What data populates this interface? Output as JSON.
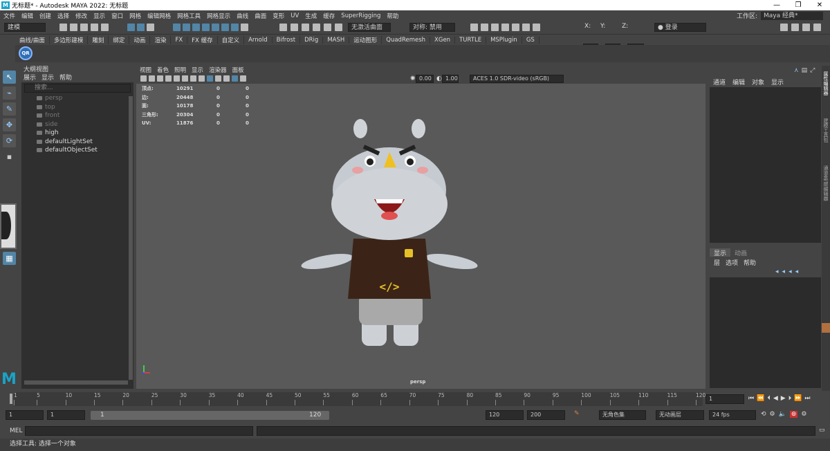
{
  "window": {
    "title": "无标题* - Autodesk MAYA 2022: 无标题",
    "logo_letter": "M",
    "controls": [
      "—",
      "❐",
      "✕"
    ]
  },
  "menubar": {
    "items": [
      "文件",
      "编辑",
      "创建",
      "选择",
      "修改",
      "显示",
      "窗口",
      "网格",
      "编辑网格",
      "网格工具",
      "网格显示",
      "曲线",
      "曲面",
      "变形",
      "UV",
      "生成",
      "缓存",
      "SuperRigging",
      "帮助"
    ]
  },
  "workspace": {
    "label": "工作区:",
    "value": "Maya 经典*"
  },
  "statusline": {
    "mode": "建模",
    "live_surface": "无激活曲面",
    "symmetry": "对称: 禁用",
    "x_label": "X:",
    "y_label": "Y:",
    "z_label": "Z:",
    "login": "登录"
  },
  "shelf": {
    "tabs": [
      "曲线/曲面",
      "多边形建模",
      "雕刻",
      "绑定",
      "动画",
      "渲染",
      "FX",
      "FX 缓存",
      "自定义",
      "Arnold",
      "Bifrost",
      "DRig",
      "MASH",
      "运动图形",
      "QuadRemesh",
      "XGen",
      "TURTLE",
      "MSPlugin",
      "GS"
    ],
    "qr_label": "QR"
  },
  "outliner": {
    "title": "大纲视图",
    "menu": [
      "展示",
      "显示",
      "帮助"
    ],
    "search_placeholder": "搜索...",
    "items": [
      {
        "label": "persp",
        "dim": true
      },
      {
        "label": "top",
        "dim": true
      },
      {
        "label": "front",
        "dim": true
      },
      {
        "label": "side",
        "dim": true
      },
      {
        "label": "high",
        "dim": false
      },
      {
        "label": "defaultLightSet",
        "dim": false
      },
      {
        "label": "defaultObjectSet",
        "dim": false
      }
    ]
  },
  "viewport": {
    "menu": [
      "视图",
      "着色",
      "照明",
      "显示",
      "渲染器",
      "面板"
    ],
    "exposure": "0.00",
    "gamma": "1.00",
    "colorspace": "ACES 1.0 SDR-video (sRGB)",
    "camera_label": "persp",
    "hud": [
      {
        "label": "顶点:",
        "values": [
          "10291",
          "0",
          "0"
        ]
      },
      {
        "label": "边:",
        "values": [
          "20448",
          "0",
          "0"
        ]
      },
      {
        "label": "面:",
        "values": [
          "10178",
          "0",
          "0"
        ]
      },
      {
        "label": "三角形:",
        "values": [
          "20304",
          "0",
          "0"
        ]
      },
      {
        "label": "UV:",
        "values": [
          "11876",
          "0",
          "0"
        ]
      }
    ]
  },
  "channelbox": {
    "menu": [
      "通道",
      "编辑",
      "对象",
      "显示"
    ]
  },
  "layereditor": {
    "tabs": [
      "显示",
      "动画"
    ],
    "menu": [
      "层",
      "选项",
      "帮助"
    ]
  },
  "sidetabs": [
    "属性编辑器",
    "建模工具包",
    "通道盒/层编辑器"
  ],
  "timeslider": {
    "ticks": [
      "1",
      "5",
      "10",
      "15",
      "20",
      "25",
      "30",
      "35",
      "40",
      "45",
      "50",
      "55",
      "60",
      "65",
      "70",
      "75",
      "80",
      "85",
      "90",
      "95",
      "100",
      "105",
      "110",
      "115",
      "120"
    ],
    "current_frame": "1"
  },
  "rangeslider": {
    "start": "1",
    "playback_start": "1",
    "range_start_label": "1",
    "range_end_label": "120",
    "playback_end": "120",
    "end": "200",
    "character_set": "无角色集",
    "anim_layer": "无动画层",
    "fps": "24 fps"
  },
  "cmdline": {
    "label": "MEL"
  },
  "helpline": {
    "text": "选择工具: 选择一个对象"
  },
  "colors": {
    "maya_blue": "#1aa3c7",
    "selection_blue": "#5285a6",
    "panel": "#444444",
    "viewport_bg": "#595959",
    "keyframe_red": "#c83232"
  }
}
